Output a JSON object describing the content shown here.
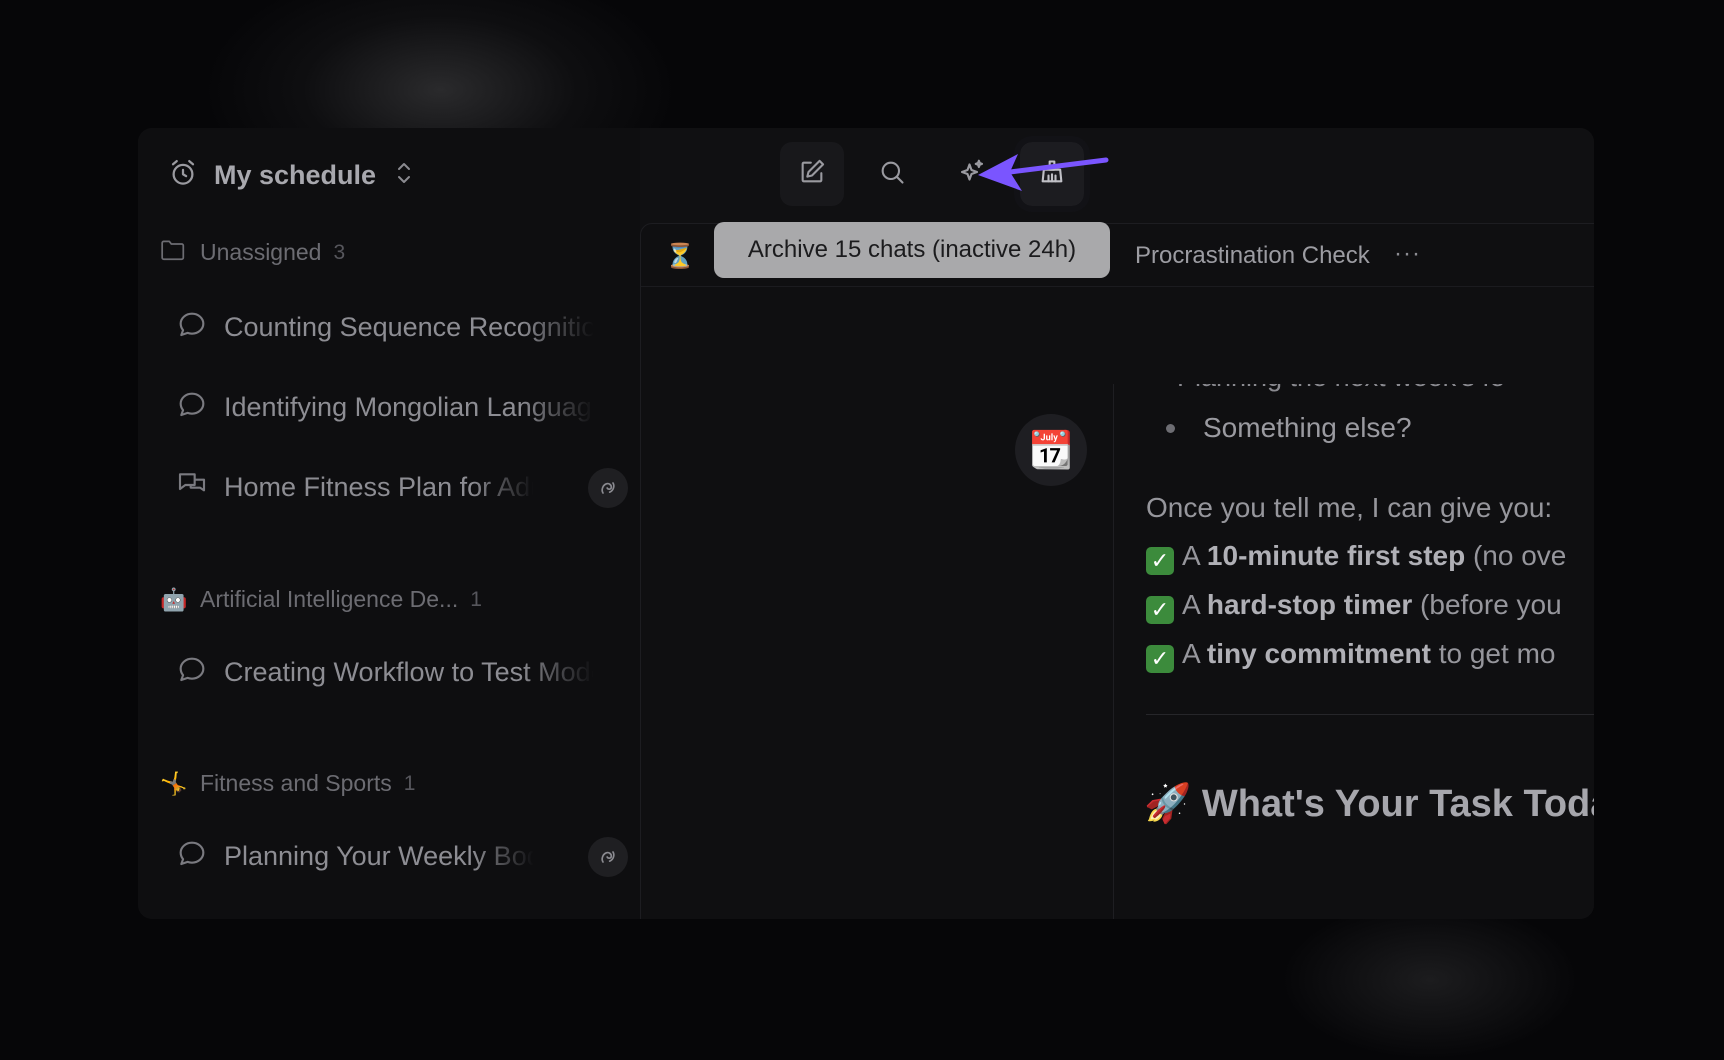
{
  "workspace": {
    "title": "My schedule"
  },
  "sidebar": {
    "groups": [
      {
        "label": "Unassigned",
        "count": "3",
        "icon": "folder-icon",
        "chats": [
          {
            "label": "Counting Sequence Recognition"
          },
          {
            "label": "Identifying Mongolian Language"
          },
          {
            "label": "Home Fitness Plan for Adults"
          }
        ]
      },
      {
        "label": "Artificial Intelligence De...",
        "count": "1",
        "emoji": "🤖",
        "chats": [
          {
            "label": "Creating Workflow to Test Models"
          }
        ]
      },
      {
        "label": "Fitness and Sports",
        "count": "1",
        "emoji": "🤸",
        "chats": [
          {
            "label": "Planning Your Weekly Body Workout"
          }
        ]
      }
    ]
  },
  "toolbar": {
    "tooltip": "Archive 15 chats (inactive 24h)"
  },
  "tab": {
    "icon": "⏳",
    "title": "Procrastination Check",
    "more": "···"
  },
  "avatar_emoji": "📆",
  "message": {
    "cut_line": "• Planning the next week's fe",
    "bullet": "Something else?",
    "intro": "Once you tell me, I can give you:",
    "items": [
      {
        "prefix": "A ",
        "bold": "10-minute first step",
        "rest": " (no ove"
      },
      {
        "prefix": "A ",
        "bold": "hard-stop timer",
        "rest": " (before you"
      },
      {
        "prefix": "A ",
        "bold": "tiny commitment",
        "rest": " to get mo"
      }
    ],
    "heading_emoji": "🚀",
    "heading": "What's Your Task Toda"
  },
  "colors": {
    "arrow": "#7a55ff",
    "check": "#3c8b3c"
  }
}
